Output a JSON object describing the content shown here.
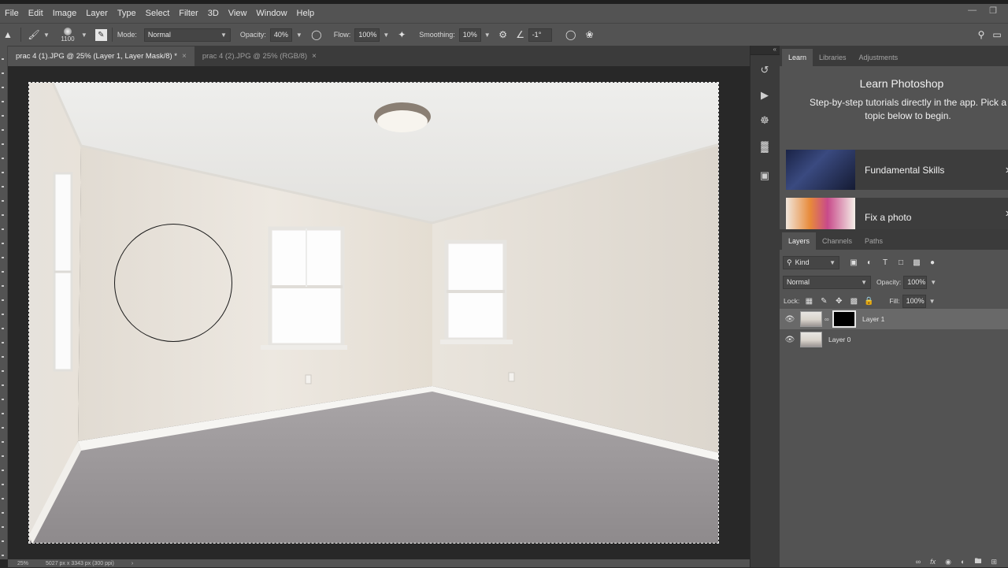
{
  "menubar": {
    "items": [
      "File",
      "Edit",
      "Image",
      "Layer",
      "Type",
      "Select",
      "Filter",
      "3D",
      "View",
      "Window",
      "Help"
    ]
  },
  "options_bar": {
    "brush_size": "1100",
    "mode_label": "Mode:",
    "mode_value": "Normal",
    "opacity_label": "Opacity:",
    "opacity_value": "40%",
    "flow_label": "Flow:",
    "flow_value": "100%",
    "smoothing_label": "Smoothing:",
    "smoothing_value": "10%",
    "angle_value": "-1°"
  },
  "tabs": [
    {
      "label": "prac 4 (1).JPG @ 25% (Layer 1, Layer Mask/8) *",
      "active": true
    },
    {
      "label": "prac 4 (2).JPG @ 25% (RGB/8)",
      "active": false
    }
  ],
  "status": {
    "zoom": "25%",
    "doc_info": "5027 px x 3343 px (300 ppi)"
  },
  "learn_panel": {
    "tabs": [
      "Learn",
      "Libraries",
      "Adjustments"
    ],
    "title": "Learn Photoshop",
    "subtitle_line1": "Step-by-step tutorials directly in the app. Pick a",
    "subtitle_line2": "topic below to begin.",
    "cards": [
      "Fundamental Skills",
      "Fix a photo"
    ]
  },
  "layers_panel": {
    "tabs": [
      "Layers",
      "Channels",
      "Paths"
    ],
    "filter_kind": "Kind",
    "blend_mode": "Normal",
    "opacity_label": "Opacity:",
    "opacity_value": "100%",
    "lock_label": "Lock:",
    "fill_label": "Fill:",
    "fill_value": "100%",
    "layers": [
      {
        "name": "Layer 1",
        "selected": true,
        "has_mask": true
      },
      {
        "name": "Layer 0",
        "selected": false,
        "has_mask": false
      }
    ]
  },
  "icons": {
    "brush": "brush-icon",
    "search": "search-icon",
    "visibility": "eye-icon"
  }
}
